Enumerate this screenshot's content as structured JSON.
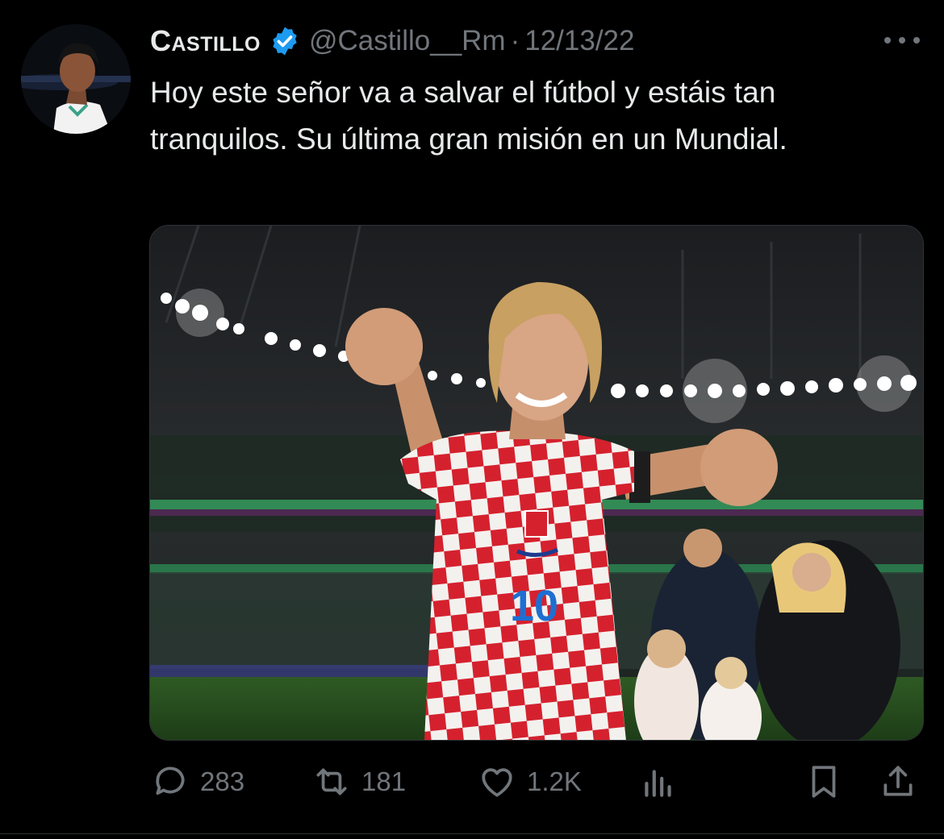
{
  "tweet": {
    "author_name": "Castillo",
    "handle": "@Castillo__Rm",
    "separator": "·",
    "date": "12/13/22",
    "text": "Hoy este señor va a salvar el fútbol y estáis tan tranquilos. Su última gran misión en un Mundial."
  },
  "media": {
    "jersey_number": "10"
  },
  "actions": {
    "replies": "283",
    "retweets": "181",
    "likes": "1.2K"
  },
  "colors": {
    "background": "#000000",
    "text": "#e7e9ea",
    "muted": "#71767b",
    "verified": "#1d9bf0"
  },
  "icons": [
    "more-icon",
    "verified-badge-icon",
    "reply-icon",
    "retweet-icon",
    "like-icon",
    "views-icon",
    "bookmark-icon",
    "share-icon"
  ]
}
